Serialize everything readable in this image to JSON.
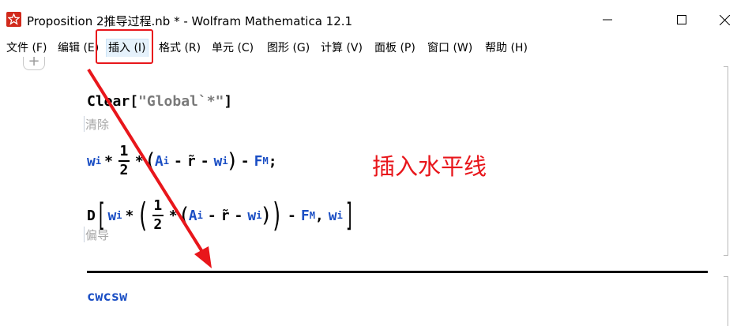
{
  "window": {
    "title": "Proposition 2推导过程.nb * - Wolfram Mathematica 12.1"
  },
  "menu": {
    "items": [
      {
        "label": "文件 (F)"
      },
      {
        "label": "编辑 (E)"
      },
      {
        "label": "插入 (I)"
      },
      {
        "label": "格式 (R)"
      },
      {
        "label": "单元 (C)"
      },
      {
        "label": "图形 (G)"
      },
      {
        "label": "计算 (V)"
      },
      {
        "label": "面板 (P)"
      },
      {
        "label": "窗口 (W)"
      },
      {
        "label": "帮助 (H)"
      }
    ]
  },
  "notebook": {
    "plus": "+",
    "cell1": {
      "fn": "Clear",
      "open": "[",
      "str": "\"Global`*\"",
      "close": "]",
      "hint": "清除"
    },
    "cell2": {
      "w": "w",
      "i": "i",
      "times": "*",
      "one": "1",
      "two": "2",
      "A": "A",
      "minus": "-",
      "rt": "r̃",
      "F": "F",
      "M": "M",
      "semi": ";"
    },
    "cell3": {
      "D": "D",
      "comma": ",",
      "hint": "偏导"
    },
    "annotation": "插入水平线",
    "input_text": "cwcsw"
  },
  "colors": {
    "accent_red": "#e8161b",
    "symbol_blue": "#1a4ec4",
    "mathematica_red": "#d12a1c"
  }
}
